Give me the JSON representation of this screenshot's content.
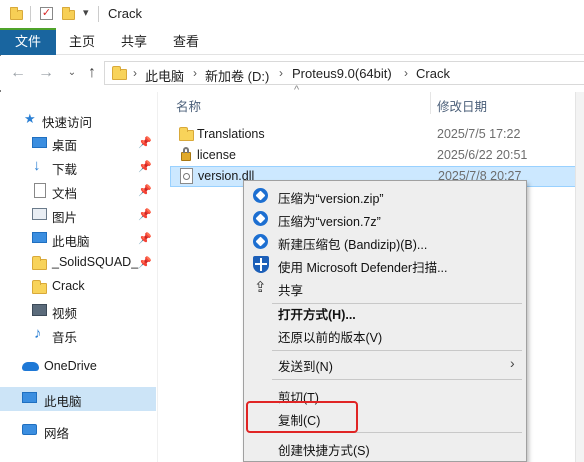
{
  "window": {
    "title": "Crack",
    "title_dropdown": "▾"
  },
  "ribbon": {
    "tabs": [
      "文件",
      "主页",
      "共享",
      "查看"
    ]
  },
  "address": {
    "crumbs": [
      "此电脑",
      "新加卷 (D:)",
      "Proteus9.0(64bit)",
      "Crack"
    ]
  },
  "sidebar": {
    "quick_access": "快速访问",
    "items": [
      {
        "label": "桌面",
        "pinned": true
      },
      {
        "label": "下载",
        "pinned": true
      },
      {
        "label": "文档",
        "pinned": true
      },
      {
        "label": "图片",
        "pinned": true
      },
      {
        "label": "此电脑",
        "pinned": true
      },
      {
        "label": "_SolidSQUAD_",
        "pinned": true
      },
      {
        "label": "Crack",
        "pinned": false
      },
      {
        "label": "视频",
        "pinned": false
      },
      {
        "label": "音乐",
        "pinned": false
      }
    ],
    "onedrive": "OneDrive",
    "this_pc": "此电脑",
    "network": "网络"
  },
  "filelist": {
    "col_name": "名称",
    "col_date": "修改日期",
    "rows": [
      {
        "name": "Translations",
        "date": "2025/7/5 17:22",
        "icon": "folder-icon"
      },
      {
        "name": "license",
        "date": "2025/6/22 20:51",
        "icon": "lock-icon"
      },
      {
        "name": "version.dll",
        "date": "2025/7/8 20:27",
        "icon": "dll-file-icon"
      }
    ]
  },
  "context_menu": {
    "items": [
      {
        "label": "压缩为“version.zip”",
        "icon": "bandizip-icon"
      },
      {
        "label": "压缩为“version.7z”",
        "icon": "bandizip-icon"
      },
      {
        "label": "新建压缩包 (Bandizip)(B)...",
        "icon": "bandizip-icon"
      },
      {
        "label": "使用 Microsoft Defender扫描...",
        "icon": "defender-shield-icon"
      },
      {
        "label": "共享",
        "icon": "share-icon"
      },
      {
        "label": "打开方式(H)...",
        "bold": true
      },
      {
        "label": "还原以前的版本(V)"
      },
      {
        "label": "发送到(N)",
        "submenu": true
      },
      {
        "label": "剪切(T)"
      },
      {
        "label": "复制(C)",
        "highlighted": true
      },
      {
        "label": "创建快捷方式(S)"
      }
    ]
  },
  "colors": {
    "accent_file_tab": "#19659f",
    "selection": "#cce8ff",
    "highlight_box": "#e02424"
  }
}
